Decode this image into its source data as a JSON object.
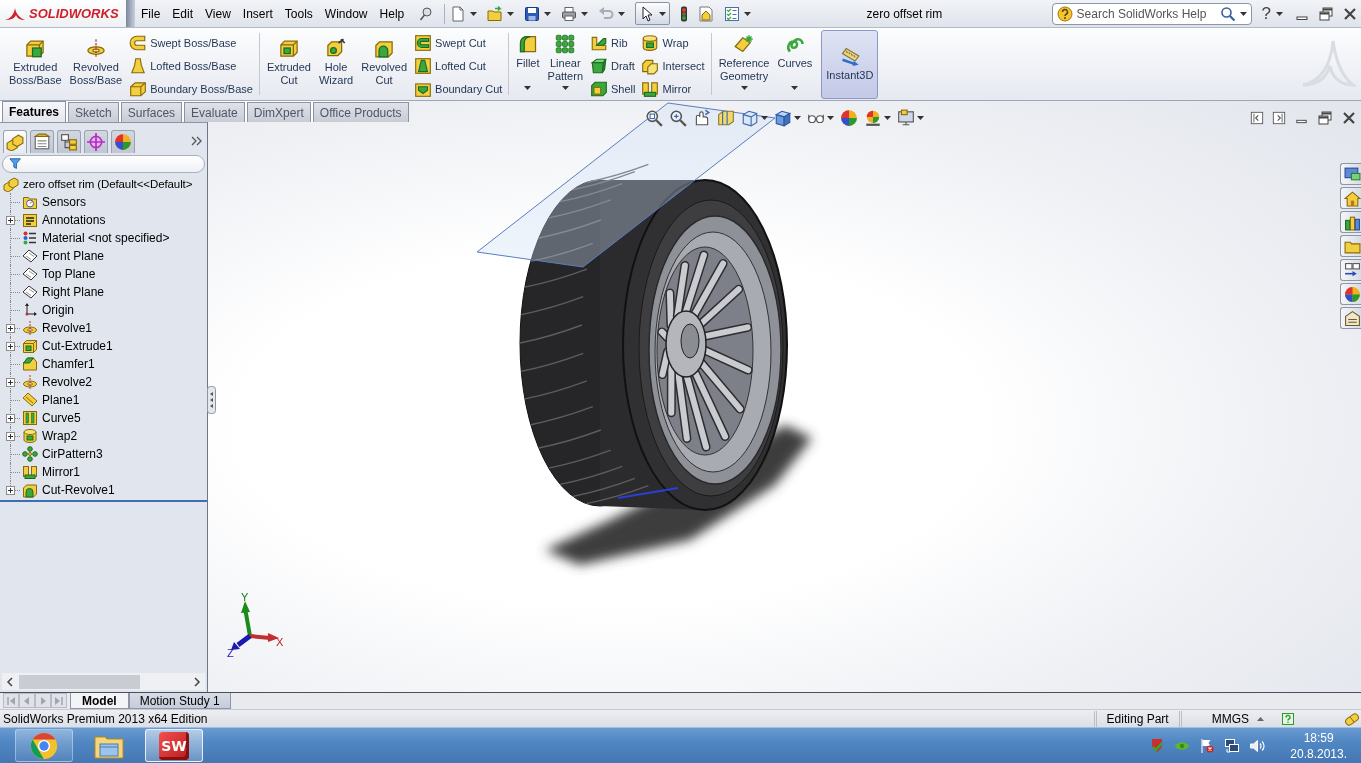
{
  "title_bar": {
    "logo_text": "SOLIDWORKS",
    "menu": [
      "File",
      "Edit",
      "View",
      "Insert",
      "Tools",
      "Window",
      "Help"
    ],
    "document_title": "zero offset rim",
    "search": {
      "placeholder": "Search SolidWorks Help"
    },
    "help_label": "?"
  },
  "command_manager": {
    "groups": [
      {
        "items": [
          {
            "kind": "large",
            "label": "Extruded Boss/Base",
            "dropdown": false,
            "on": false
          },
          {
            "kind": "large",
            "label": "Revolved Boss/Base",
            "dropdown": false,
            "on": false
          },
          {
            "kind": "stack",
            "items": [
              {
                "label": "Swept Boss/Base"
              },
              {
                "label": "Lofted Boss/Base"
              },
              {
                "label": "Boundary Boss/Base"
              }
            ]
          }
        ]
      },
      {
        "items": [
          {
            "kind": "large",
            "label": "Extruded Cut",
            "dropdown": false,
            "on": false
          },
          {
            "kind": "large",
            "label": "Hole Wizard",
            "dropdown": false,
            "on": false
          },
          {
            "kind": "large",
            "label": "Revolved Cut",
            "dropdown": false,
            "on": false
          },
          {
            "kind": "stack",
            "items": [
              {
                "label": "Swept Cut"
              },
              {
                "label": "Lofted Cut"
              },
              {
                "label": "Boundary Cut"
              }
            ]
          }
        ]
      },
      {
        "items": [
          {
            "kind": "large",
            "label": "Fillet",
            "dropdown": true,
            "on": false
          },
          {
            "kind": "large",
            "label": "Linear Pattern",
            "dropdown": true,
            "on": false
          },
          {
            "kind": "stack",
            "items": [
              {
                "label": "Rib"
              },
              {
                "label": "Draft"
              },
              {
                "label": "Shell"
              }
            ]
          },
          {
            "kind": "stack",
            "items": [
              {
                "label": "Wrap"
              },
              {
                "label": "Intersect"
              },
              {
                "label": "Mirror"
              }
            ]
          }
        ]
      },
      {
        "items": [
          {
            "kind": "large",
            "label": "Reference Geometry",
            "dropdown": true,
            "on": false
          },
          {
            "kind": "large",
            "label": "Curves",
            "dropdown": true,
            "on": false
          },
          {
            "kind": "large",
            "label": "Instant3D",
            "dropdown": false,
            "on": true
          }
        ]
      }
    ]
  },
  "command_tabs": [
    {
      "label": "Features",
      "selected": true
    },
    {
      "label": "Sketch",
      "selected": false
    },
    {
      "label": "Surfaces",
      "selected": false
    },
    {
      "label": "Evaluate",
      "selected": false
    },
    {
      "label": "DimXpert",
      "selected": false
    },
    {
      "label": "Office Products",
      "selected": false
    }
  ],
  "feature_manager": {
    "panel_tabs": [
      {
        "selected": true
      },
      {
        "selected": false
      },
      {
        "selected": false
      },
      {
        "selected": false
      },
      {
        "selected": false
      }
    ],
    "tree": {
      "label": "zero offset rim (Default<<Default>",
      "children": [
        {
          "label": "Sensors",
          "expandable": false
        },
        {
          "label": "Annotations",
          "expandable": true
        },
        {
          "label": "Material <not specified>",
          "expandable": false
        },
        {
          "label": "Front Plane",
          "expandable": false
        },
        {
          "label": "Top Plane",
          "expandable": false
        },
        {
          "label": "Right Plane",
          "expandable": false
        },
        {
          "label": "Origin",
          "expandable": false
        },
        {
          "label": "Revolve1",
          "expandable": true
        },
        {
          "label": "Cut-Extrude1",
          "expandable": true
        },
        {
          "label": "Chamfer1",
          "expandable": false
        },
        {
          "label": "Revolve2",
          "expandable": true
        },
        {
          "label": "Plane1",
          "expandable": false
        },
        {
          "label": "Curve5",
          "expandable": true
        },
        {
          "label": "Wrap2",
          "expandable": true
        },
        {
          "label": "CirPattern3",
          "expandable": false
        },
        {
          "label": "Mirror1",
          "expandable": false
        },
        {
          "label": "Cut-Revolve1",
          "expandable": true
        }
      ]
    }
  },
  "viewport": {
    "axis_labels": [
      "X",
      "Y",
      "Z"
    ]
  },
  "bottom_tabs": [
    {
      "label": "Model",
      "selected": true
    },
    {
      "label": "Motion Study 1",
      "selected": false
    }
  ],
  "status_bar": {
    "edition": "SolidWorks Premium 2013 x64 Edition",
    "mode": "Editing Part",
    "units": "MMGS"
  },
  "taskbar": {
    "apps": [
      {
        "kind": "browser",
        "running": true,
        "selected": false
      },
      {
        "kind": "folder",
        "running": false,
        "selected": false
      },
      {
        "kind": "cad",
        "logo_text": "SW",
        "running": true,
        "selected": true
      }
    ],
    "clock": {
      "time": "18:59",
      "date": "20.8.2013."
    }
  }
}
